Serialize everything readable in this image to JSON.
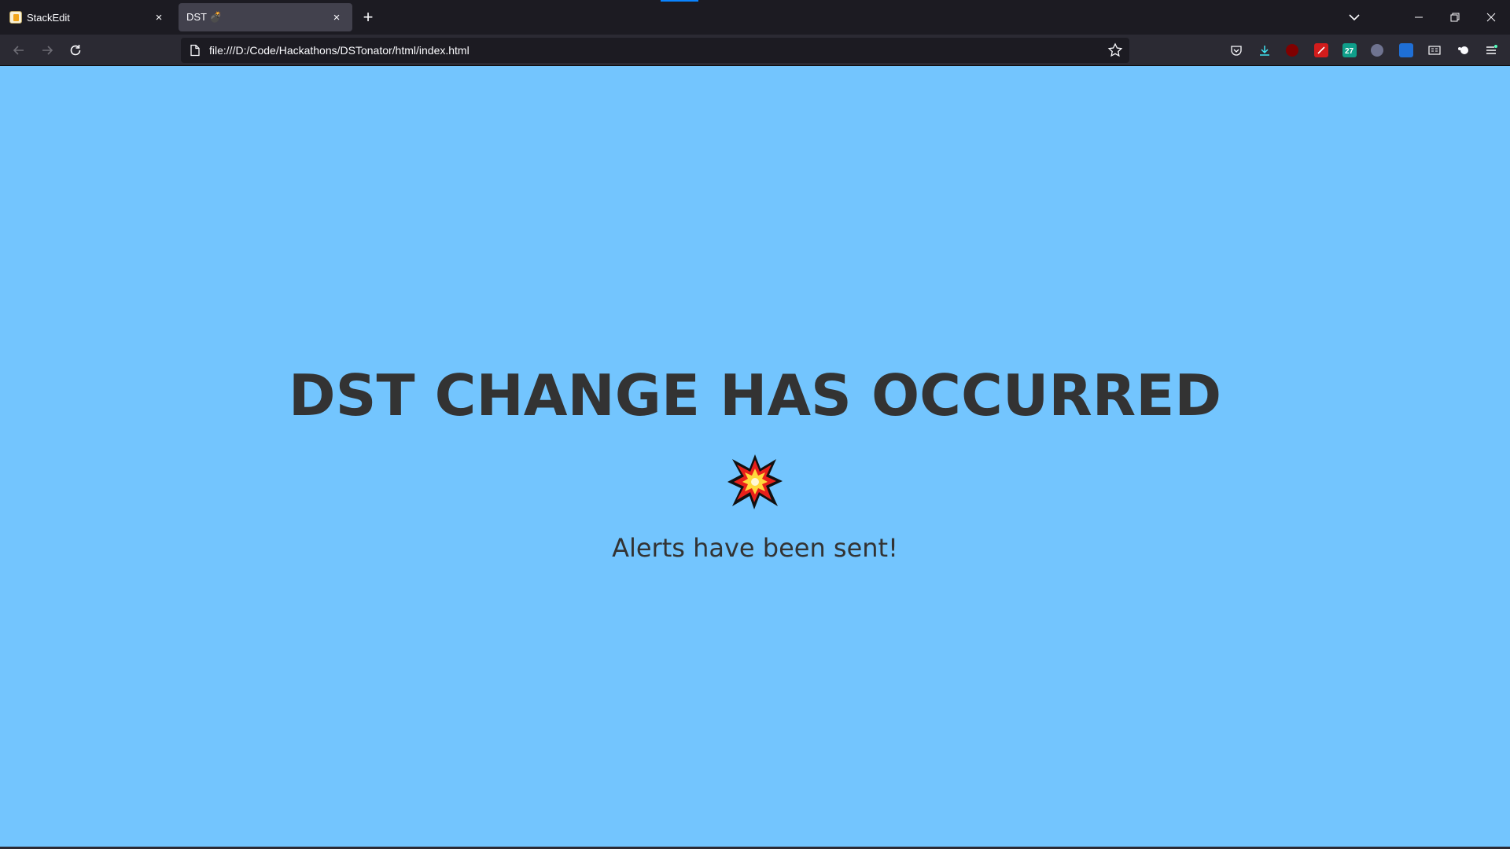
{
  "browser": {
    "tabs": [
      {
        "title": "StackEdit",
        "close": "×",
        "favicon": "stackedit-icon"
      },
      {
        "title": "DST 💣",
        "close": "×",
        "favicon": "none"
      }
    ],
    "new_tab": "+",
    "url": "file:///D:/Code/Hackathons/DSTonator/html/index.html"
  },
  "page": {
    "headline": "DST CHANGE HAS OCCURRED",
    "icon": "collision-icon",
    "message": "Alerts have been sent!"
  },
  "colors": {
    "page_background": "#73c5fe",
    "text": "#333333",
    "chrome": "#1c1b22",
    "toolbar": "#2b2a33",
    "active_tab": "#42414d"
  }
}
